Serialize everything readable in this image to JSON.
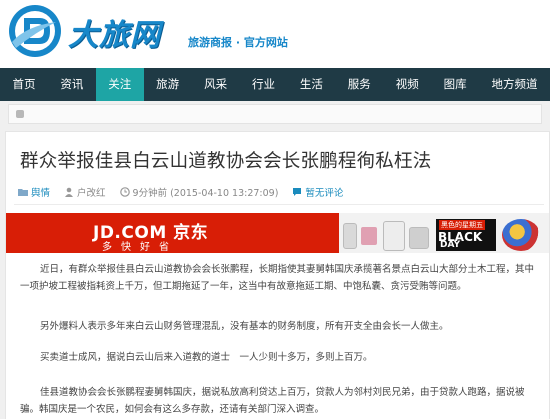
{
  "site": {
    "brand": "大旅网",
    "slogan": "旅游商报 · 官方网站",
    "colors": {
      "nav_bg": "#1f3a45",
      "nav_active": "#1ea5a5",
      "brand_blue": "#1787c9",
      "jd_red": "#d81e06"
    }
  },
  "nav": {
    "items": [
      {
        "label": "首页"
      },
      {
        "label": "资讯"
      },
      {
        "label": "关注",
        "active": true
      },
      {
        "label": "旅游"
      },
      {
        "label": "风采"
      },
      {
        "label": "行业"
      },
      {
        "label": "生活"
      },
      {
        "label": "服务"
      },
      {
        "label": "视频"
      },
      {
        "label": "图库"
      },
      {
        "label": "地方频道"
      }
    ]
  },
  "article": {
    "title": "群众举报佳县白云山道教协会会长张鹏程徇私枉法",
    "meta": {
      "category": "舆情",
      "author": "户改红",
      "time": "9分钟前 (2015-04-10 13:27:09)",
      "comment": "暂无评论"
    },
    "ad": {
      "jd_logo": "JD.COM 京东",
      "jd_slogan": "多快好省",
      "promo_top": "黑色的星期五",
      "promo_main_line1": "BLACK",
      "promo_main_line2": "DAY"
    },
    "paragraphs": [
      "近日，有群众举报佳县白云山道教协会会长张鹏程，长期指使其妻舅韩国庆承揽著名景点白云山大部分土木工程，其中一项护坡工程被指耗资上千万，但工期拖延了一年，这当中有故意拖延工期、中饱私囊、贪污受贿等问题。",
      "另外爆料人表示多年来白云山财务管理混乱，没有基本的财务制度，所有开支全由会长一人做主。",
      "买卖道士成风，据说白云山后来入道教的道士　一人少则十多万，多则上百万。",
      "佳县道教协会会长张鹏程妻舅韩国庆，据说私放高利贷达上百万，贷款人为邻村刘民兄弟，由于贷款人跑路，据说被骗。韩国庆是一个农民，如何会有这么多存款，还请有关部门深入调查。"
    ]
  }
}
